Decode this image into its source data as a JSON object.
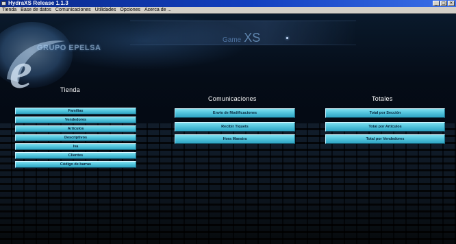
{
  "window": {
    "title": "HydraXS Release 1.1.3",
    "buttons": [
      "_",
      "□",
      "✕"
    ]
  },
  "menu": {
    "items": [
      "Tienda",
      "Base de datos",
      "Comunicaciones",
      "Utilidades",
      "Opciones",
      "Acerca de ..."
    ]
  },
  "logo": {
    "text": "GRUPO EPELSA",
    "letter": "e",
    "colors": {
      "ring": "#9fc3e6",
      "fill": "#4c7fb8"
    }
  },
  "brand": {
    "prefix": "Game",
    "suffix": "XS"
  },
  "sections": {
    "tienda": {
      "title": "Tienda",
      "buttons": [
        "Familias",
        "Vendedores",
        "Artículos",
        "Descriptivos",
        "Iva",
        "Clientes",
        "Código de barras"
      ]
    },
    "comunicaciones": {
      "title": "Comunicaciones",
      "buttons": [
        "Envío de Modificaciones",
        "Recibir Tiquets",
        "Hora Maestra"
      ]
    },
    "totales": {
      "title": "Totales",
      "buttons": [
        "Total por Sección",
        "Total por Artículos",
        "Total por Vendedores"
      ]
    }
  },
  "colors": {
    "button_top": "#7fe0f0",
    "button_bottom": "#2fa5c4",
    "button_text": "#06253c",
    "background": "#03070f",
    "titlebar": "#123fbf"
  }
}
